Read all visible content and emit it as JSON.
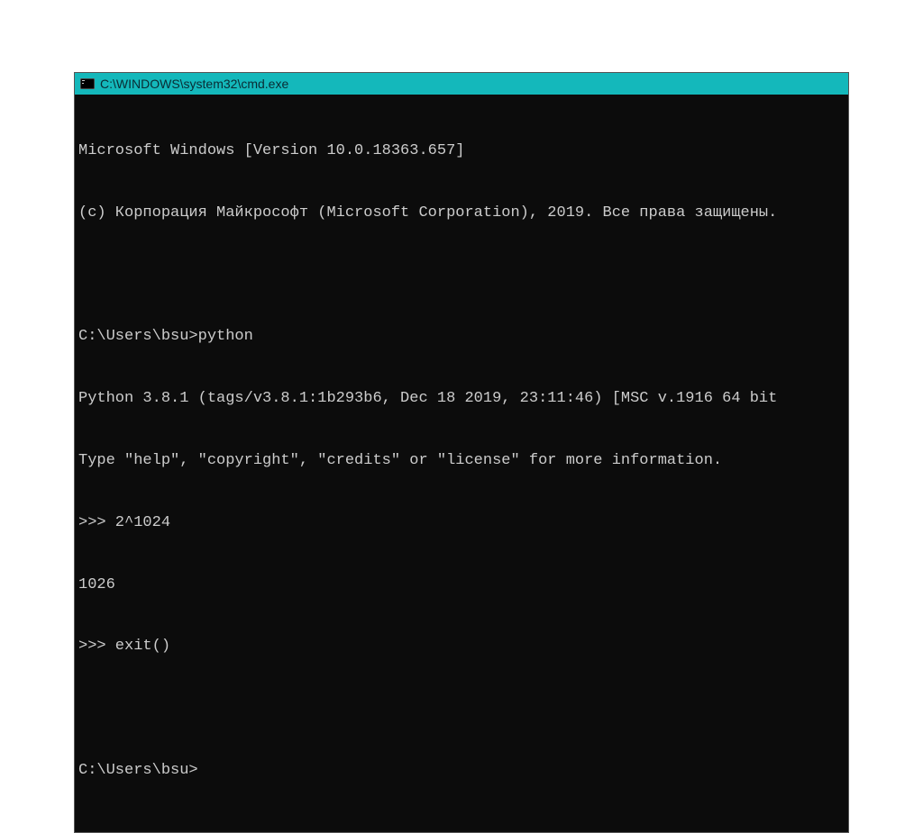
{
  "window": {
    "title": "C:\\WINDOWS\\system32\\cmd.exe"
  },
  "terminal": {
    "lines": [
      "Microsoft Windows [Version 10.0.18363.657]",
      "(c) Корпорация Майкрософт (Microsoft Corporation), 2019. Все права защищены.",
      "",
      "C:\\Users\\bsu>python",
      "Python 3.8.1 (tags/v3.8.1:1b293b6, Dec 18 2019, 23:11:46) [MSC v.1916 64 bit",
      "Type \"help\", \"copyright\", \"credits\" or \"license\" for more information.",
      ">>> 2^1024",
      "1026",
      ">>> exit()",
      "",
      "C:\\Users\\bsu>"
    ]
  }
}
